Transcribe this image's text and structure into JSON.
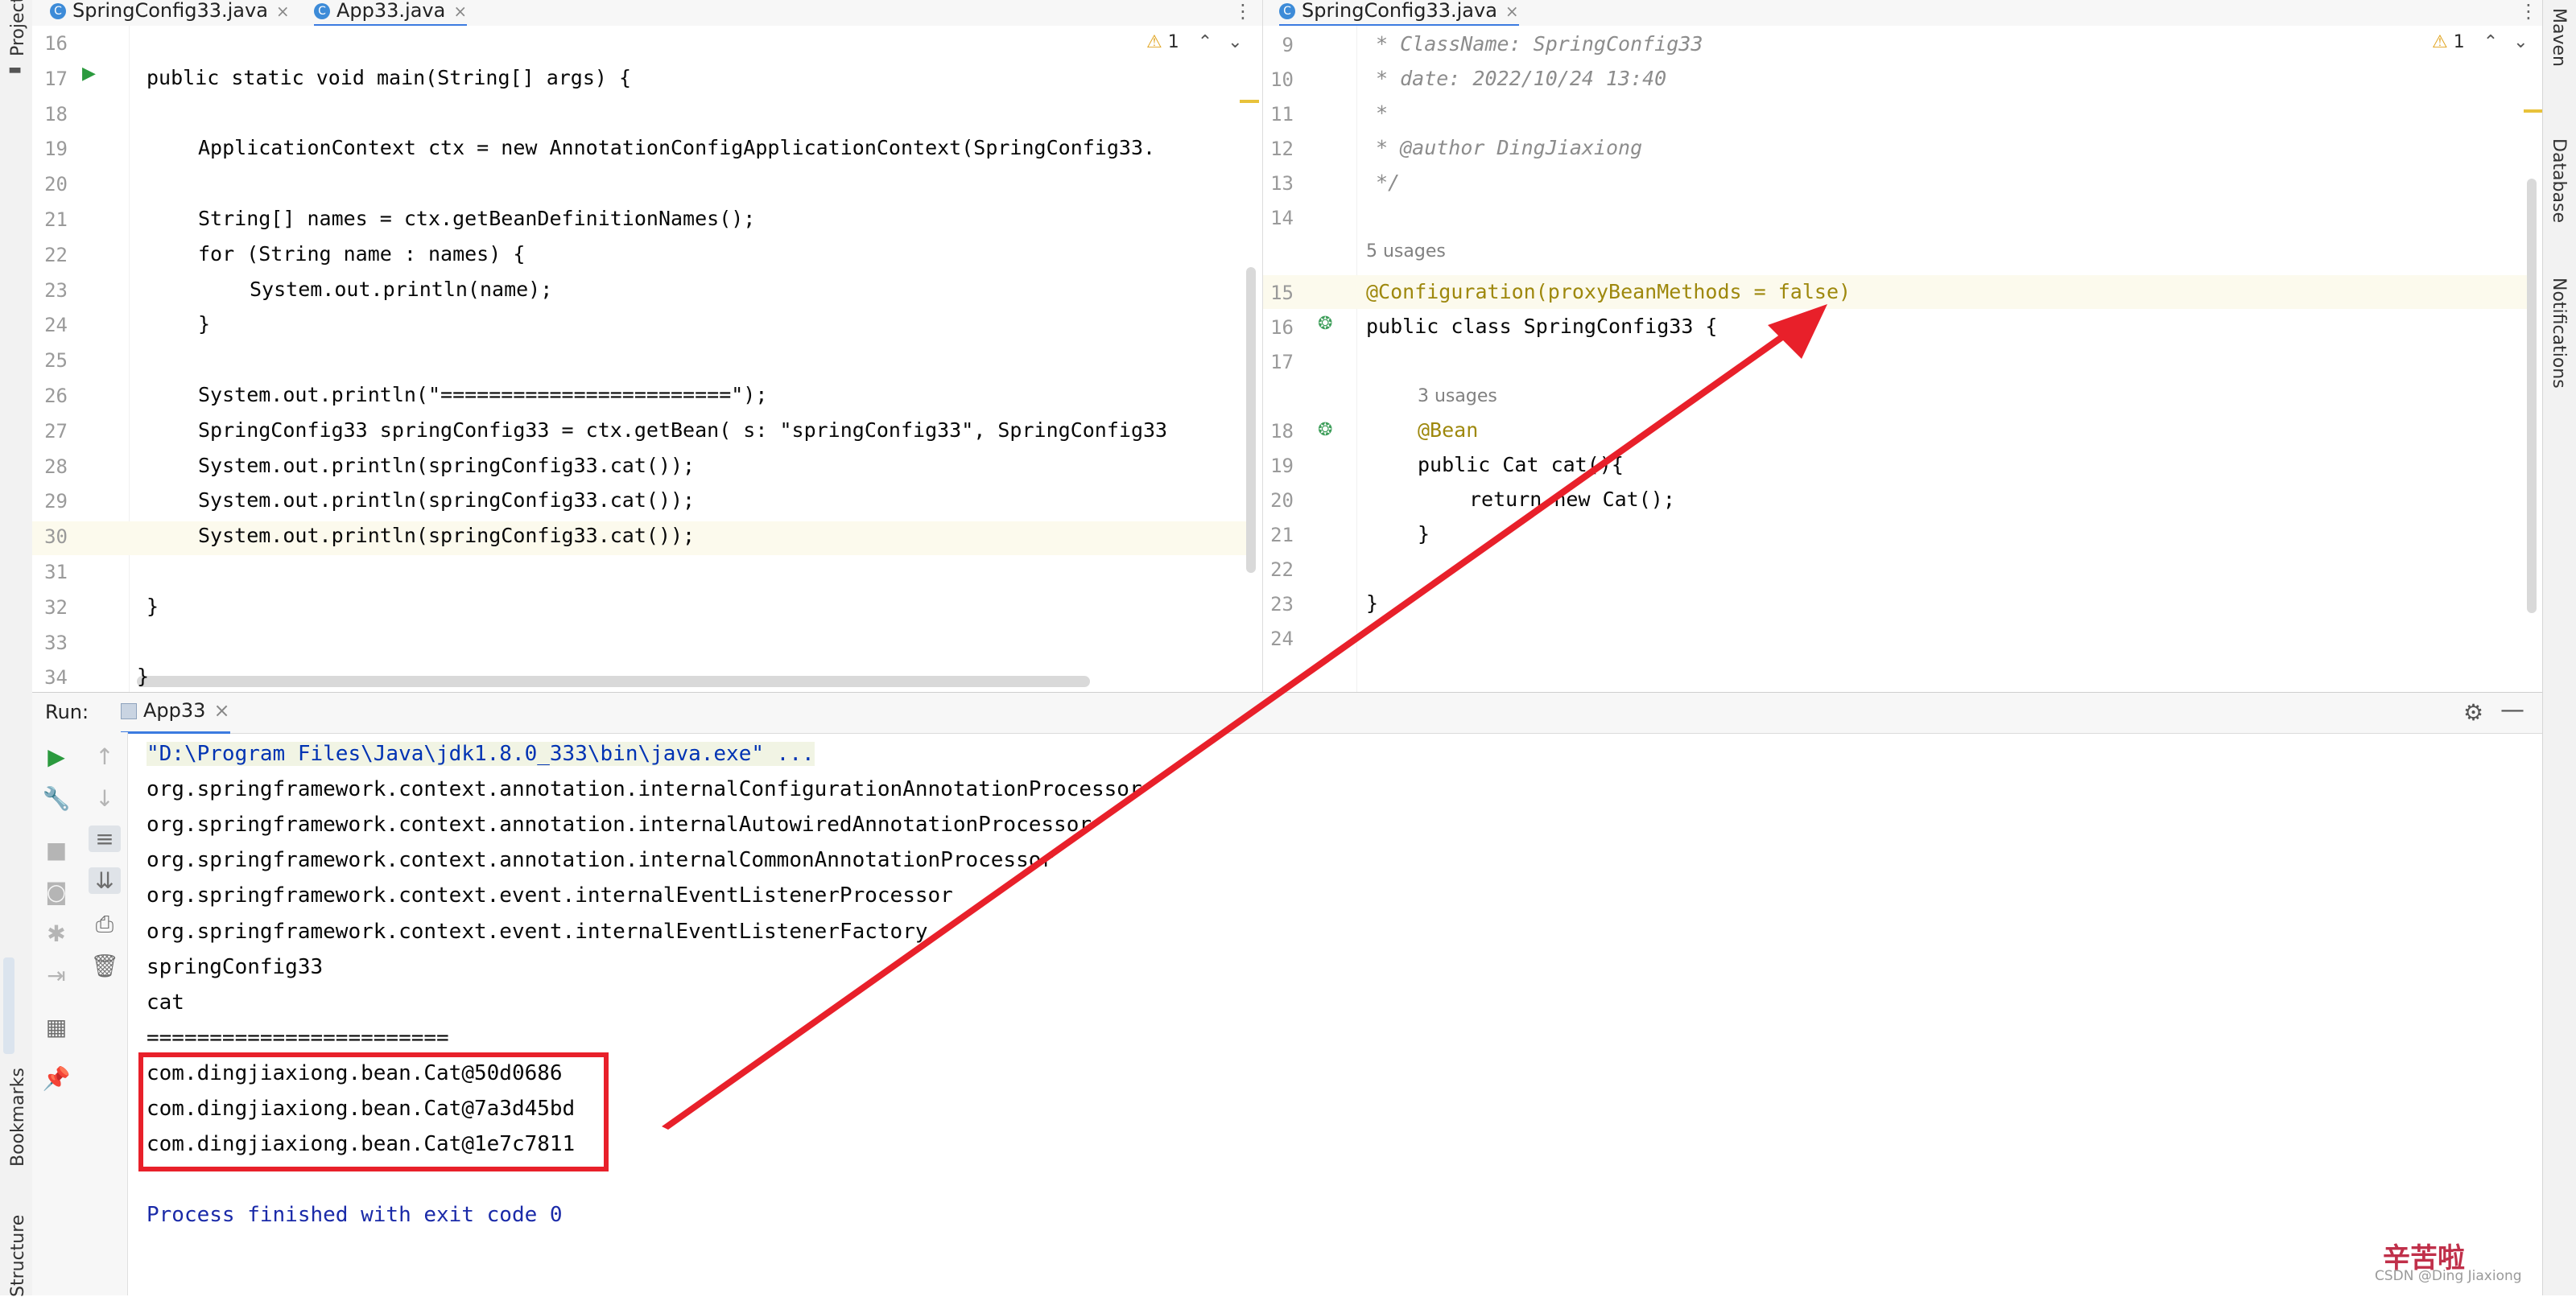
{
  "left_tabs": [
    {
      "label": "SpringConfig33.java",
      "active": false
    },
    {
      "label": "App33.java",
      "active": true
    }
  ],
  "right_tabs": [
    {
      "label": "SpringConfig33.java",
      "active": true
    }
  ],
  "left_strip": {
    "project": "Project",
    "bookmarks": "Bookmarks",
    "structure": "Structure"
  },
  "right_strip": {
    "maven": "Maven",
    "database": "Database",
    "notifications": "Notifications"
  },
  "left_editor": {
    "warning_count": "1",
    "lines": [
      {
        "n": "16",
        "text": ""
      },
      {
        "n": "17",
        "text": "public static void main(String[] args) {"
      },
      {
        "n": "18",
        "text": ""
      },
      {
        "n": "19",
        "text": "ApplicationContext ctx = new AnnotationConfigApplicationContext(SpringConfig33."
      },
      {
        "n": "20",
        "text": ""
      },
      {
        "n": "21",
        "text": "String[] names = ctx.getBeanDefinitionNames();"
      },
      {
        "n": "22",
        "text": "for (String name : names) {"
      },
      {
        "n": "23",
        "text": "System.out.println(name);"
      },
      {
        "n": "24",
        "text": "}"
      },
      {
        "n": "25",
        "text": ""
      },
      {
        "n": "26",
        "text": "System.out.println(\"========================\");"
      },
      {
        "n": "27",
        "text": "SpringConfig33 springConfig33 = ctx.getBean( s: \"springConfig33\", SpringConfig33"
      },
      {
        "n": "28",
        "text": "System.out.println(springConfig33.cat());"
      },
      {
        "n": "29",
        "text": "System.out.println(springConfig33.cat());"
      },
      {
        "n": "30",
        "text": "System.out.println(springConfig33.cat());"
      },
      {
        "n": "31",
        "text": ""
      },
      {
        "n": "32",
        "text": "}"
      },
      {
        "n": "33",
        "text": ""
      },
      {
        "n": "34",
        "text": "}"
      }
    ]
  },
  "right_editor": {
    "warning_count": "1",
    "lines": [
      {
        "n": "9",
        "text": "* ClassName: SpringConfig33"
      },
      {
        "n": "10",
        "text": "* date: 2022/10/24 13:40"
      },
      {
        "n": "11",
        "text": "*"
      },
      {
        "n": "12",
        "text": "* @author DingJiaxiong"
      },
      {
        "n": "13",
        "text": "*/"
      },
      {
        "n": "14",
        "text": ""
      },
      {
        "n": "15",
        "text": "@Configuration(proxyBeanMethods = false)"
      },
      {
        "n": "16",
        "text": "public class SpringConfig33 {"
      },
      {
        "n": "17",
        "text": ""
      },
      {
        "n": "18",
        "text": "@Bean"
      },
      {
        "n": "19",
        "text": "public Cat cat(){"
      },
      {
        "n": "20",
        "text": "return new Cat();"
      },
      {
        "n": "21",
        "text": "}"
      },
      {
        "n": "22",
        "text": ""
      },
      {
        "n": "23",
        "text": "}"
      },
      {
        "n": "24",
        "text": ""
      }
    ],
    "usages_class": "5 usages",
    "usages_bean": "3 usages"
  },
  "run_panel": {
    "label": "Run:",
    "tab": "App33",
    "console": [
      "\"D:\\Program Files\\Java\\jdk1.8.0_333\\bin\\java.exe\" ...",
      "org.springframework.context.annotation.internalConfigurationAnnotationProcessor",
      "org.springframework.context.annotation.internalAutowiredAnnotationProcessor",
      "org.springframework.context.annotation.internalCommonAnnotationProcessor",
      "org.springframework.context.event.internalEventListenerProcessor",
      "org.springframework.context.event.internalEventListenerFactory",
      "springConfig33",
      "cat",
      "========================",
      "com.dingjiaxiong.bean.Cat@50d0686",
      "com.dingjiaxiong.bean.Cat@7a3d45bd",
      "com.dingjiaxiong.bean.Cat@1e7c7811",
      "",
      "Process finished with exit code 0"
    ]
  },
  "watermark": {
    "title": "辛苦啦",
    "credit": "CSDN @Ding Jiaxiong"
  },
  "colors": {
    "annotation_red": "#e8202a",
    "keyword": "#0033b3",
    "string": "#067d17"
  }
}
